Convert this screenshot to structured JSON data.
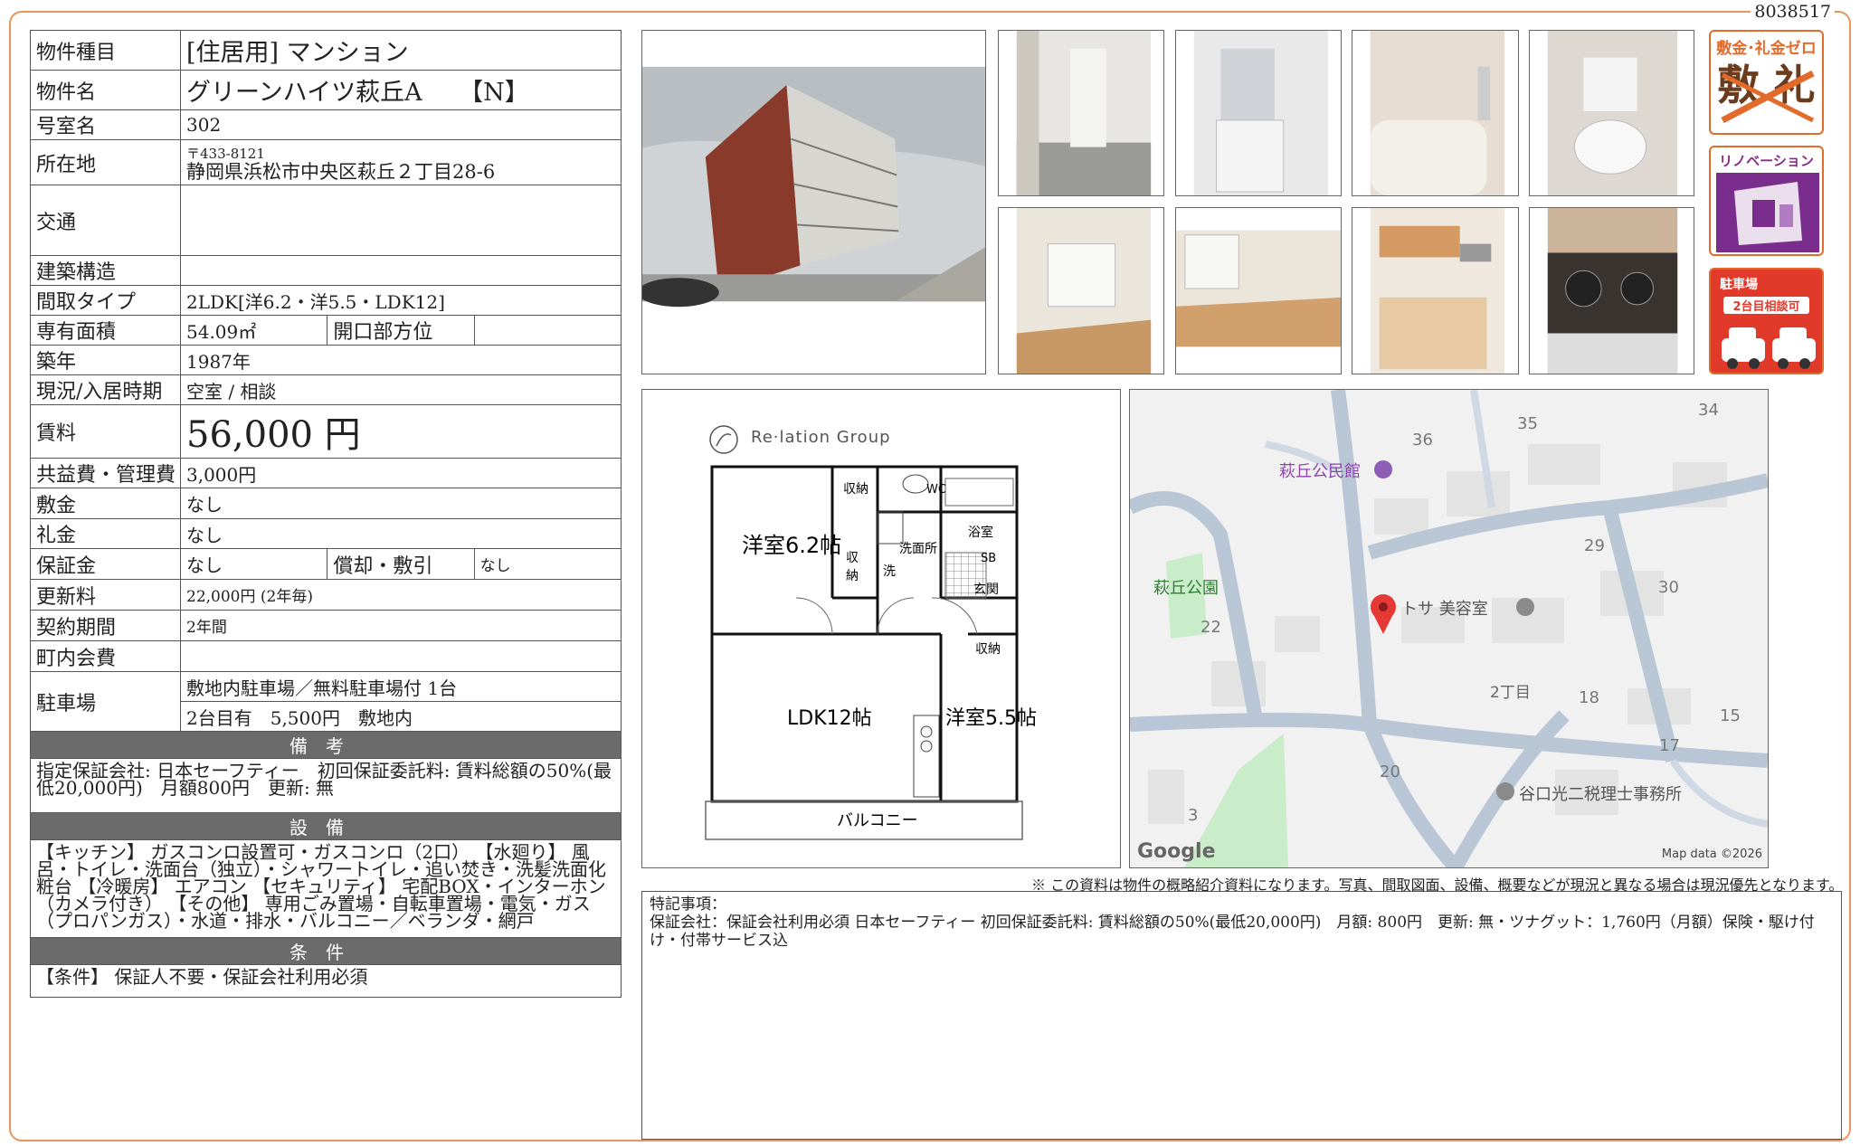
{
  "doc_id": "8038517",
  "property": {
    "type_label": "物件種目",
    "type_value": "[住居用] マンション",
    "name_label": "物件名",
    "name_value": "グリーンハイツ萩丘A　　【N】",
    "room_label": "号室名",
    "room_value": "302",
    "address_label": "所在地",
    "postal": "〒433-8121",
    "address_value": "静岡県浜松市中央区萩丘２丁目28-6",
    "access_label": "交通",
    "access_value": "",
    "structure_label": "建築構造",
    "structure_value": "",
    "layout_label": "間取タイプ",
    "layout_value": "2LDK[洋6.2・洋5.5・LDK12]",
    "area_label": "専有面積",
    "area_value": "54.09㎡",
    "direction_label": "開口部方位",
    "direction_value": "",
    "built_label": "築年",
    "built_value": "1987年",
    "status_label": "現況/入居時期",
    "status_value": "空室 / 相談",
    "rent_label": "賃料",
    "rent_value": "56,000 円",
    "fee_label": "共益費・管理費",
    "fee_value": "3,000円",
    "deposit_label": "敷金",
    "deposit_value": "なし",
    "keymoney_label": "礼金",
    "keymoney_value": "なし",
    "guarantee_label": "保証金",
    "guarantee_value": "なし",
    "amort_label": "償却・敷引",
    "amort_value": "なし",
    "renewal_label": "更新料",
    "renewal_value": "22,000円 (2年毎)",
    "term_label": "契約期間",
    "term_value": "2年間",
    "community_label": "町内会費",
    "community_value": "",
    "parking_label": "駐車場",
    "parking_value1": "敷地内駐車場／無料駐車場付 1台",
    "parking_value2": "2台目有　5,500円　敷地内"
  },
  "sections": {
    "remarks_title": "備考",
    "remarks_text": "指定保証会社: 日本セーフティー　初回保証委託料: 賃料総額の50%(最低20,000円)　月額800円　更新: 無",
    "equipment_title": "設備",
    "equipment_text": "【キッチン】 ガスコンロ設置可・ガスコンロ（2口） 【水廻り】 風呂・トイレ・洗面台（独立）・シャワートイレ・追い焚き・洗髪洗面化粧台 【冷暖房】 エアコン 【セキュリティ】 宅配BOX・インターホン（カメラ付き） 【その他】 専用ごみ置場・自転車置場・電気・ガス（プロパンガス）・水道・排水・バルコニー／ベランダ・網戸",
    "conditions_title": "条件",
    "conditions_text": "【条件】 保証人不要・保証会社利用必須"
  },
  "badges": {
    "zero_title": "敷金･礼金ゼロ",
    "zero_marks": "敷 礼",
    "renov_title": "リノベーション",
    "parking_title": "駐車場",
    "parking_sub": "2台目相談可"
  },
  "floorplan": {
    "logo_text": "Re·lation Group",
    "room1": "洋室6.2帖",
    "room2": "LDK12帖",
    "room3": "洋室5.5帖",
    "balcony": "バルコニー",
    "storage": "収納",
    "wc": "WC",
    "bath": "浴室",
    "washroom": "洗面所",
    "wash": "洗",
    "sb": "SB",
    "entrance": "玄関",
    "closet_a": "収",
    "closet_b": "納"
  },
  "map": {
    "label_hall": "萩丘公民館",
    "label_park": "萩丘公園",
    "label_salon": "トサ 美容室",
    "label_tax": "谷口光二税理士事務所",
    "label_chome": "2丁目",
    "numbers": [
      "36",
      "35",
      "34",
      "29",
      "30",
      "22",
      "18",
      "15",
      "17",
      "20",
      "3"
    ],
    "google": "Google",
    "mapdata": "Map data ©2026"
  },
  "disclaimer": "※ この資料は物件の概略紹介資料になります。写真、間取図面、設備、概要などが現況と異なる場合は現況優先となります。",
  "special": {
    "title": "特記事項：",
    "text": "保証会社：保証会社利用必須 日本セーフティー 初回保証委託料: 賃料総額の50%(最低20,000円)　月額: 800円　更新: 無・ツナグット：1,760円（月額）保険・駆け付け・付帯サービス込"
  }
}
